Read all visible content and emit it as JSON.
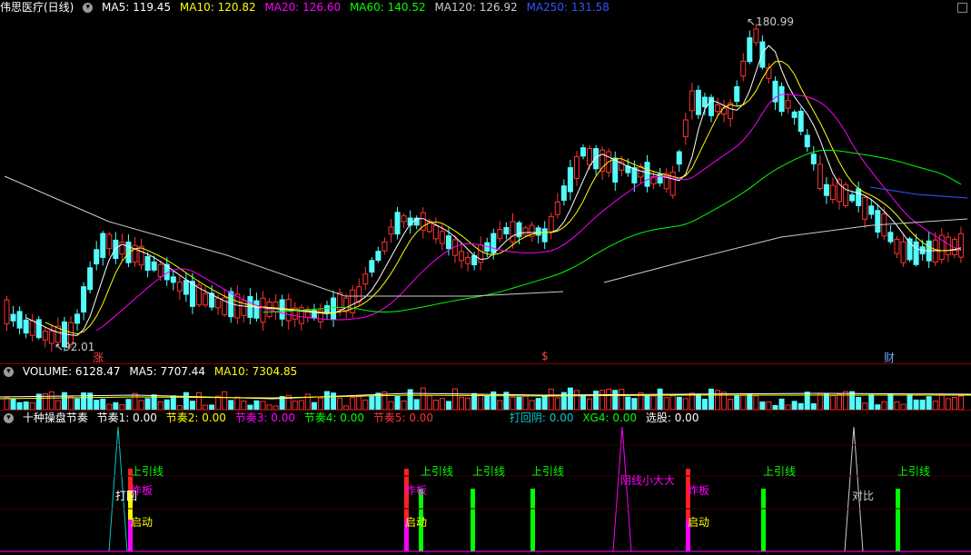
{
  "header": {
    "stock": "伟思医疗(日线)",
    "ma": [
      {
        "label": "MA5: 119.45",
        "color": "#ffffff"
      },
      {
        "label": "MA10: 120.82",
        "color": "#ffff00"
      },
      {
        "label": "MA20: 126.60",
        "color": "#ff00ff"
      },
      {
        "label": "MA60: 140.52",
        "color": "#00ff00"
      },
      {
        "label": "MA120: 126.92",
        "color": "#d0d0d0"
      },
      {
        "label": "MA250: 131.58",
        "color": "#3355ff"
      }
    ],
    "corner_icon": "close-square-icon"
  },
  "price_chart": {
    "high_label": "180.99",
    "low_label": "92.01",
    "markers": [
      {
        "text": "涨",
        "color": "#ff4444"
      },
      {
        "text": "$",
        "color": "#ff4444"
      },
      {
        "text": "财",
        "color": "#66aaff"
      }
    ]
  },
  "volume": {
    "labels": [
      {
        "text": "VOLUME: 6128.47",
        "color": "#ffffff"
      },
      {
        "text": "MA5: 7707.44",
        "color": "#ffffff"
      },
      {
        "text": "MA10: 7304.85",
        "color": "#ffff00"
      }
    ]
  },
  "indicator": {
    "labels": [
      {
        "text": "十种操盘节奏",
        "color": "#ffffff"
      },
      {
        "text": "节奏1: 0.00",
        "color": "#ffffff"
      },
      {
        "text": "节奏2: 0.00",
        "color": "#ffff00"
      },
      {
        "text": "节奏3: 0.00",
        "color": "#ff00ff"
      },
      {
        "text": "节奏4: 0.00",
        "color": "#00ff00"
      },
      {
        "text": "节奏5: 0.00",
        "color": "#ff3333"
      },
      {
        "text": "打回阴: 0.00",
        "color": "#00cccc"
      },
      {
        "text": "XG4: 0.00",
        "color": "#00ff00"
      },
      {
        "text": "选股: 0.00",
        "color": "#ffffff"
      }
    ],
    "signals": {
      "up_shadow": "上引线",
      "pullback": "打回阴",
      "hit_back": "打回",
      "explode": "炸板",
      "start": "启动",
      "small_yin": "阴线小大大",
      "compare": "对比"
    }
  },
  "colors": {
    "up": "#ff3232",
    "down": "#54fcfc",
    "grid": "#8b0000"
  }
}
